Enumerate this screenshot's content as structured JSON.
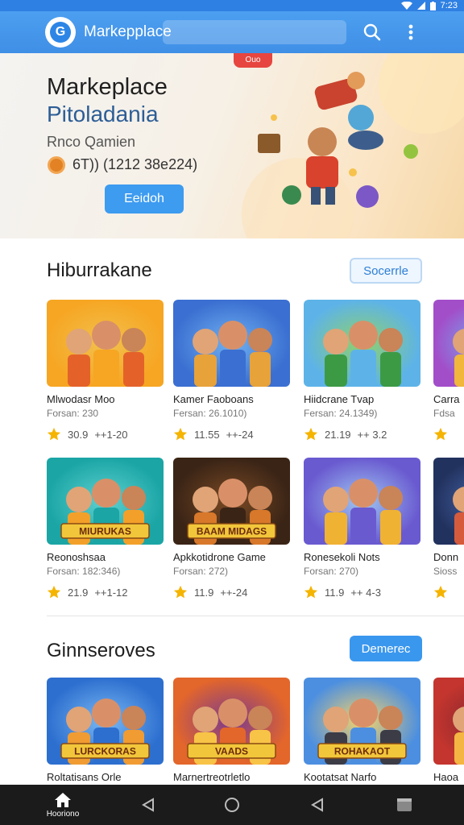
{
  "status": {
    "time": "7:23"
  },
  "app_bar": {
    "title": "Markepplace",
    "logo_letter": "G"
  },
  "hero": {
    "badge": "Ouo",
    "title": "Markeplace",
    "subtitle": "Pitoladania",
    "author": "Rnco Qamien",
    "rating": "6T)) (1212 38e224)",
    "button": "Eeidoh"
  },
  "section1": {
    "title": "Hiburrakane",
    "button": "Socerrle",
    "row1": [
      {
        "name": "Mlwodasr Moo",
        "meta": "Forsan: 230",
        "rating": "30.9",
        "count": "++1-20",
        "art": "orange",
        "badge": ""
      },
      {
        "name": "Kamer Faoboans",
        "meta": "Fersan: 26.1010)",
        "rating": "11.55",
        "count": "++-24",
        "art": "blue",
        "badge": ""
      },
      {
        "name": "Hiidcrane Tvap",
        "meta": "Fersan: 24.1349)",
        "rating": "21.19",
        "count": "++ 3.2",
        "art": "green",
        "badge": ""
      },
      {
        "name": "Carra",
        "meta": "Fdsa",
        "rating": "",
        "count": "",
        "art": "purple",
        "badge": ""
      }
    ],
    "row2": [
      {
        "name": "Reonoshsaa",
        "meta": "Forsan: 182:346)",
        "rating": "21.9",
        "count": "++1-12",
        "art": "teal",
        "badge": "MIURUKAS"
      },
      {
        "name": "Apkkotidrone Game",
        "meta": "Forsan: 272)",
        "rating": "11.9",
        "count": "++-24",
        "art": "dark",
        "badge": "BAAM MIDAGS"
      },
      {
        "name": "Ronesekoli Nots",
        "meta": "Forsan: 270)",
        "rating": "11.9",
        "count": "++ 4-3",
        "art": "violet",
        "badge": ""
      },
      {
        "name": "Donn",
        "meta": "Sioss",
        "rating": "",
        "count": "",
        "art": "navy",
        "badge": ""
      }
    ]
  },
  "section2": {
    "title": "Ginnseroves",
    "button": "Demerec",
    "row": [
      {
        "name": "Roltatisans Orle",
        "art": "blue2",
        "badge": "LURCKORAS"
      },
      {
        "name": "Marnertreotrletlo",
        "art": "fire",
        "badge": "VAADS"
      },
      {
        "name": "Kootatsat Narfo",
        "art": "sky",
        "badge": "ROHAKAOT"
      },
      {
        "name": "Haoa",
        "art": "red",
        "badge": ""
      }
    ]
  },
  "nav": {
    "home_label": "Hooriono"
  },
  "colors": {
    "primary": "#3a97ee",
    "app_bar": "#4c9ff0",
    "star": "#f5b400"
  }
}
